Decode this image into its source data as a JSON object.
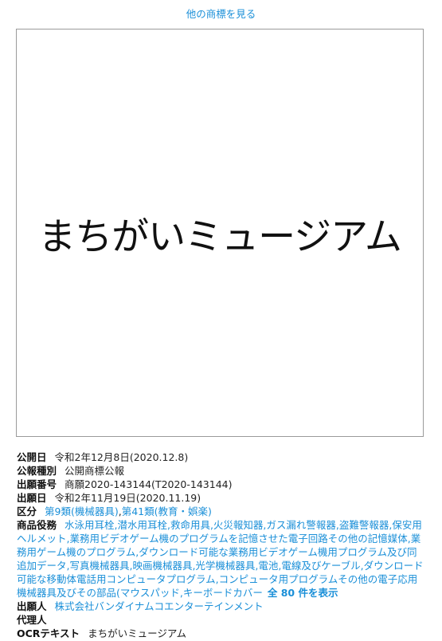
{
  "other_marks_link": "他の商標を見る",
  "mark_image_text": "まちがいミュージアム",
  "details": {
    "pub_date": {
      "label": "公開日",
      "value": "令和2年12月8日(2020.12.8)"
    },
    "pub_type": {
      "label": "公報種別",
      "value": "公開商標公報"
    },
    "app_number": {
      "label": "出願番号",
      "value": "商願2020-143144(T2020-143144)"
    },
    "app_date": {
      "label": "出願日",
      "value": "令和2年11月19日(2020.11.19)"
    },
    "classes": {
      "label": "区分",
      "items": [
        "第9類(機械器具)",
        "第41類(教育・娯楽)"
      ]
    },
    "goods": {
      "label": "商品役務",
      "text": "水泳用耳栓,潜水用耳栓,救命用具,火災報知器,ガス漏れ警報器,盗難警報器,保安用ヘルメット,業務用ビデオゲーム機のプログラムを記憶させた電子回路その他の記憶媒体,業務用ゲーム機のプログラム,ダウンロード可能な業務用ビデオゲーム機用プログラム及び同追加データ,写真機械器具,映画機械器具,光学機械器具,電池,電線及びケーブル,ダウンロード可能な移動体電話用コンピュータプログラム,コンピュータ用プログラムその他の電子応用機械器具及びその部品(マウスパッド,キーボードカバー",
      "more": "全 80 件を表示"
    },
    "applicant": {
      "label": "出願人",
      "value": "株式会社バンダイナムコエンターテインメント"
    },
    "agent": {
      "label": "代理人",
      "value": ""
    },
    "ocr": {
      "label": "OCRテキスト",
      "value": "まちがいミュージアム"
    }
  },
  "colors": {
    "link": "#1a8fd8",
    "border": "#9a9a9a"
  }
}
